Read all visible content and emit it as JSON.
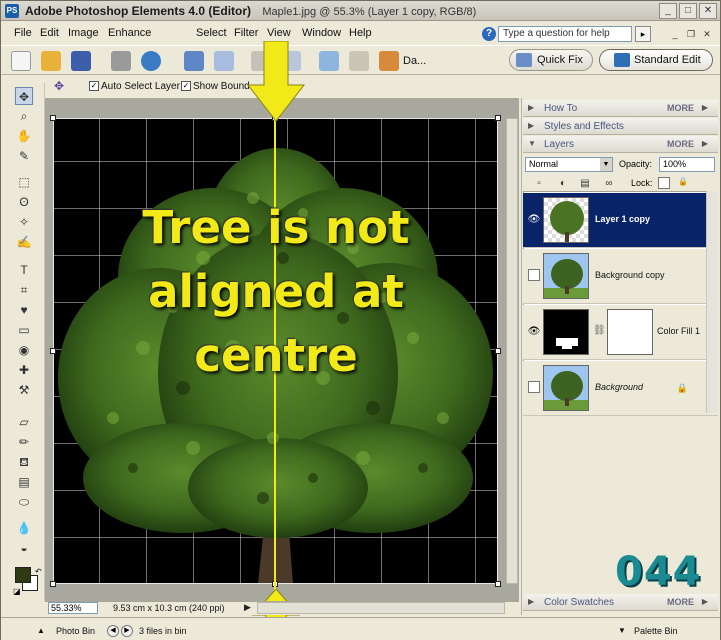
{
  "titlebar": {
    "app_title": "Adobe Photoshop Elements 4.0 (Editor)",
    "doc_title": "Maple1.jpg @ 55.3% (Layer 1 copy, RGB/8)"
  },
  "menu": {
    "items": [
      "File",
      "Edit",
      "Image",
      "Enhance",
      "Select",
      "Filter",
      "View",
      "Window",
      "Help"
    ],
    "help_placeholder": "Type a question for help"
  },
  "shortcuts": {
    "date_label": "Da...",
    "quick_fix": "Quick Fix",
    "standard_edit": "Standard Edit"
  },
  "options": {
    "auto_select_layer": "Auto Select Layer",
    "show_bounding_box": "Show Bound"
  },
  "canvas": {
    "annotation": "Tree is not\naligned at\ncentre"
  },
  "status": {
    "zoom": "55.33%",
    "doc_info": "9.53 cm x 10.3 cm (240 ppi)"
  },
  "palette_bin": {
    "how_to": "How To",
    "styles_effects": "Styles and Effects",
    "layers": "Layers",
    "color_swatches": "Color Swatches",
    "more": "MORE"
  },
  "layers_panel": {
    "blend_mode": "Normal",
    "opacity_label": "Opacity:",
    "opacity_value": "100%",
    "lock_label": "Lock:",
    "layers": [
      {
        "name": "Layer 1 copy",
        "visible": true,
        "selected": true
      },
      {
        "name": "Background copy",
        "visible": false,
        "selected": false
      },
      {
        "name": "Color Fill 1",
        "visible": true,
        "selected": false
      },
      {
        "name": "Background",
        "visible": false,
        "selected": false,
        "locked": true
      }
    ]
  },
  "watermark": "044",
  "bottom": {
    "photo_bin": "Photo Bin",
    "files_in_bin": "3 files in bin",
    "palette_bin": "Palette Bin"
  },
  "colors": {
    "guide": "#f2ea18",
    "selected_layer": "#0a246a",
    "foreground": "#2d3a14",
    "background": "#ffffff",
    "watermark": "#1a8a93"
  }
}
